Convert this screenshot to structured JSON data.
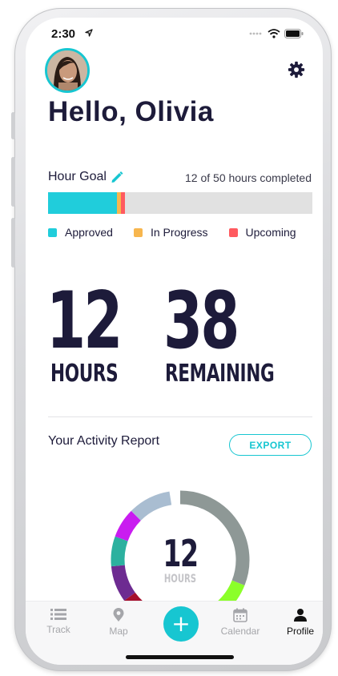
{
  "status_bar": {
    "time": "2:30",
    "location_icon": "location-arrow-icon",
    "signal_icon": "signal-dots-icon",
    "wifi_icon": "wifi-icon",
    "battery_icon": "battery-icon"
  },
  "header": {
    "avatar_icon": "user-avatar",
    "settings_icon": "gear-icon",
    "greeting": "Hello, Olivia"
  },
  "hour_goal": {
    "label": "Hour Goal",
    "edit_icon": "pencil-icon",
    "progress_text": "12 of 50 hours completed",
    "completed_hours": 12,
    "goal_hours": 50,
    "segments": [
      {
        "name": "Approved",
        "fraction": 0.26,
        "color": "#20cddb"
      },
      {
        "name": "In Progress",
        "fraction": 0.015,
        "color": "#f7b64e"
      },
      {
        "name": "Upcoming",
        "fraction": 0.015,
        "color": "#ff5a5f"
      }
    ]
  },
  "legend": [
    {
      "label": "Approved",
      "color": "#20cddb"
    },
    {
      "label": "In Progress",
      "color": "#f7b64e"
    },
    {
      "label": "Upcoming",
      "color": "#ff5a5f"
    }
  ],
  "stats": {
    "hours": {
      "value": "12",
      "caption": "HOURS"
    },
    "remaining": {
      "value": "38",
      "caption": "REMAINING"
    }
  },
  "activity": {
    "title": "Your Activity Report",
    "export_label": "EXPORT",
    "center_value": "12",
    "center_caption": "HOURS",
    "segments": [
      {
        "fraction": 0.31,
        "color": "#8e9896"
      },
      {
        "fraction": 0.075,
        "color": "#8bff29"
      },
      {
        "fraction": 0.065,
        "color": "#22c7b4"
      },
      {
        "fraction": 0.1,
        "color": "#efefef"
      },
      {
        "fraction": 0.03,
        "color": "#2aa5a9"
      },
      {
        "fraction": 0.07,
        "color": "#a60f2c"
      },
      {
        "fraction": 0.085,
        "color": "#6d2b91"
      },
      {
        "fraction": 0.07,
        "color": "#2cb19f"
      },
      {
        "fraction": 0.07,
        "color": "#c91cf0"
      },
      {
        "fraction": 0.1,
        "color": "#a9bdd1"
      }
    ]
  },
  "tab_bar": {
    "tabs": [
      {
        "label": "Track",
        "icon": "list-icon",
        "active": false
      },
      {
        "label": "Map",
        "icon": "map-pin-icon",
        "active": false
      },
      {
        "label": "Calendar",
        "icon": "calendar-icon",
        "active": false
      },
      {
        "label": "Profile",
        "icon": "person-icon",
        "active": true
      }
    ],
    "add_label": "+"
  },
  "colors": {
    "accent": "#17c6d1",
    "text_dark": "#1d1b3a"
  }
}
